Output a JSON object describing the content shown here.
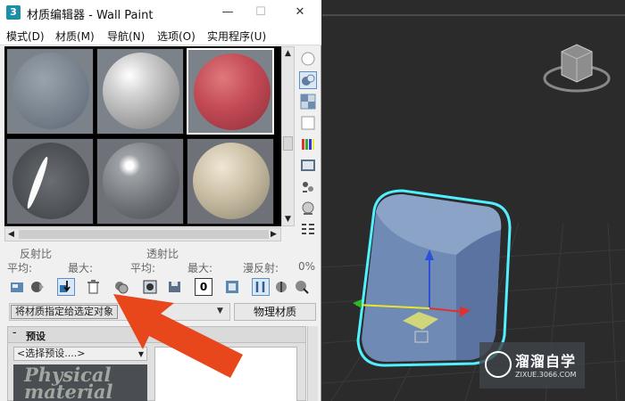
{
  "window": {
    "title": "材质编辑器 - Wall Paint",
    "app_icon_label": "3",
    "minimize": "—",
    "maximize": "☐",
    "close": "✕"
  },
  "menu": [
    "模式(D)",
    "材质(M)",
    "导航(N)",
    "选项(O)",
    "实用程序(U)"
  ],
  "labels": {
    "reflect": "反射比",
    "transmit": "透射比",
    "avg1": "平均:",
    "max1": "最大:",
    "avg2": "平均:",
    "max2": "最大:",
    "diffuse": "漫反射:",
    "percent": "0%"
  },
  "assign_tooltip": "将材质指定给选定对象",
  "material_type_button": "物理材质",
  "rollout": {
    "title": "预设",
    "preset_combo": "<选择预设....>",
    "swatch_text": "Physical material"
  },
  "watermark": {
    "brand": "溜溜自学",
    "url": "ZIXUE.3066.COM"
  },
  "colors": {
    "accent_arrow": "#e8461b",
    "selection_outline": "#52f0ff",
    "cube": "#6e89b3",
    "viewport_bg": "#2b2b2b"
  },
  "icons": [
    "sphere-icon",
    "backlight-icon",
    "checker-background-icon",
    "sample-uv-icon",
    "video-color-check-icon",
    "make-preview-icon",
    "options-icon",
    "select-by-material-icon",
    "material-map-navigator-icon",
    "get-material-icon",
    "put-to-scene-icon",
    "assign-to-selection-icon",
    "reset-map-icon",
    "make-copy-icon",
    "make-unique-icon",
    "put-to-library-icon",
    "material-id-channel-icon",
    "show-shaded-icon",
    "show-end-result-icon",
    "go-to-parent-icon",
    "go-forward-icon",
    "pick-from-object-icon"
  ]
}
